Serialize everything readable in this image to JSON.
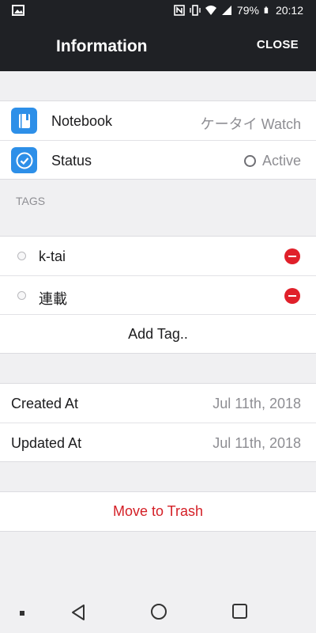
{
  "status_bar": {
    "battery": "79%",
    "time": "20:12",
    "icons": [
      "image-icon",
      "nfc-icon",
      "vibrate-icon",
      "wifi-icon",
      "signal-icon",
      "battery-icon"
    ]
  },
  "app_bar": {
    "title": "Information",
    "close_label": "CLOSE"
  },
  "info": {
    "notebook": {
      "label": "Notebook",
      "value": "ケータイ Watch",
      "icon": "notebook-icon"
    },
    "status": {
      "label": "Status",
      "value": "Active",
      "icon": "checkmark-icon"
    }
  },
  "tags": {
    "header": "TAGS",
    "items": [
      {
        "label": "k-tai"
      },
      {
        "label": "連載"
      }
    ],
    "add_label": "Add Tag.."
  },
  "dates": {
    "created": {
      "label": "Created At",
      "value": "Jul 11th, 2018"
    },
    "updated": {
      "label": "Updated At",
      "value": "Jul 11th, 2018"
    }
  },
  "actions": {
    "trash_label": "Move to Trash"
  },
  "colors": {
    "app_bar_bg": "#1f2125",
    "accent_blue": "#2d8fe8",
    "danger_red": "#d41f26",
    "page_bg": "#f0f0f2"
  }
}
